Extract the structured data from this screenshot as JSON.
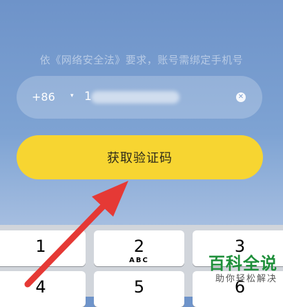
{
  "notice": "依《网络安全法》要求，账号需绑定手机号",
  "phone": {
    "country_code": "+86",
    "caret": "▾",
    "first_digit": "1",
    "clear_icon": "clear-icon"
  },
  "cta_label": "获取验证码",
  "colors": {
    "button": "#f7d531",
    "arrow": "#e53935",
    "watermark": "#1e8f3a"
  },
  "keyboard": {
    "keys": [
      {
        "digit": "1",
        "letters": ""
      },
      {
        "digit": "2",
        "letters": "ABC"
      },
      {
        "digit": "3",
        "letters": ""
      },
      {
        "digit": "4",
        "letters": ""
      },
      {
        "digit": "5",
        "letters": ""
      },
      {
        "digit": "6",
        "letters": ""
      }
    ]
  },
  "watermark": {
    "title": "百科全说",
    "subtitle": "助你轻松解决"
  }
}
